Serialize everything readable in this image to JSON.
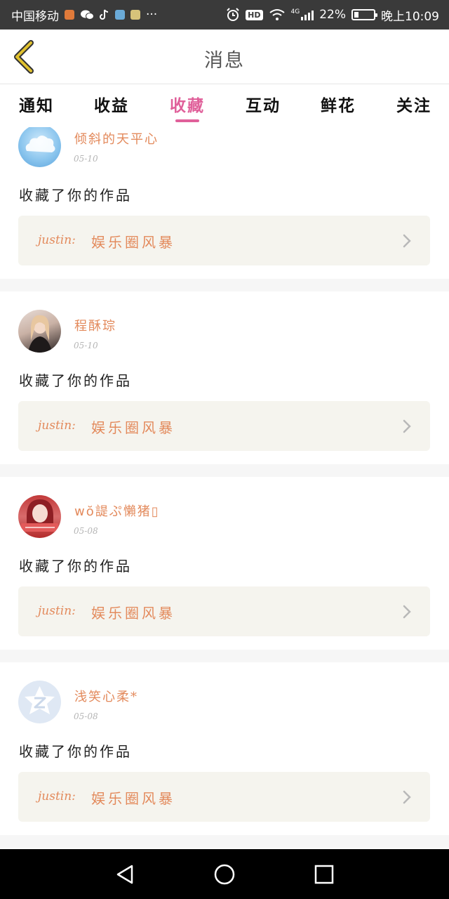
{
  "status_bar": {
    "carrier": "中国移动",
    "more": "···",
    "hd_badge": "HD",
    "network": "4G",
    "battery_percent": "22%",
    "battery_level": 0.22,
    "time": "晚上10:09"
  },
  "header": {
    "title": "消息"
  },
  "tabs": [
    {
      "label": "通知"
    },
    {
      "label": "收益"
    },
    {
      "label": "收藏"
    },
    {
      "label": "互动"
    },
    {
      "label": "鲜花"
    },
    {
      "label": "关注"
    }
  ],
  "active_tab": "收藏",
  "notifications": [
    {
      "username": "倾斜的天平心",
      "date": "05-10",
      "action": "收藏了你的作品",
      "work_author": "justin:",
      "work_title": "娱乐圈风暴"
    },
    {
      "username": "程酥琮",
      "date": "05-10",
      "action": "收藏了你的作品",
      "work_author": "justin:",
      "work_title": "娱乐圈风暴"
    },
    {
      "username": "wŏ諟ぷ懶猪▯",
      "date": "05-08",
      "action": "收藏了你的作品",
      "work_author": "justin:",
      "work_title": "娱乐圈风暴"
    },
    {
      "username": "浅笑心柔*",
      "date": "05-08",
      "action": "收藏了你的作品",
      "work_author": "justin:",
      "work_title": "娱乐圈风暴"
    }
  ],
  "colors": {
    "accent": "#e0609a",
    "username": "#e38a5c",
    "link_bg": "#f5f4ee",
    "back_icon": "#c9a227"
  },
  "icons": {
    "back": "chevron-left-icon",
    "entry": "chevron-right-icon",
    "nav_back": "triangle-back-icon",
    "nav_home": "circle-home-icon",
    "nav_recent": "square-recent-icon"
  }
}
